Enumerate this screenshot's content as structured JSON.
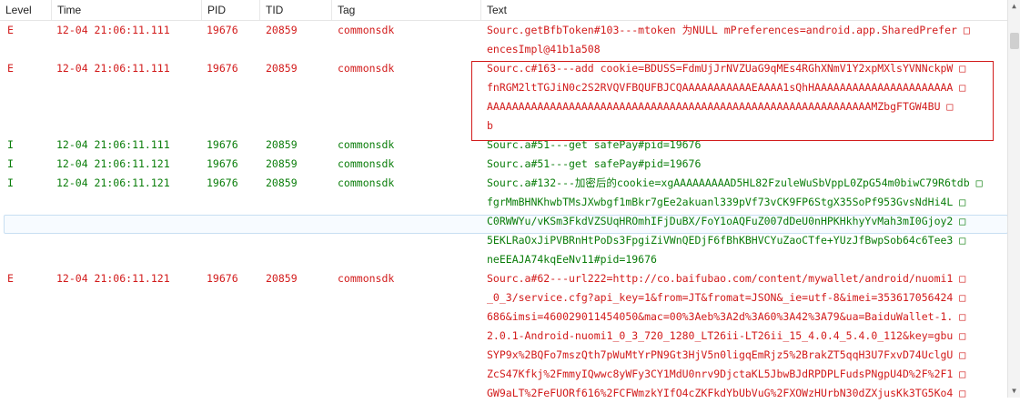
{
  "header": {
    "level": "Level",
    "time": "Time",
    "pid": "PID",
    "tid": "TID",
    "tag": "Tag",
    "text": "Text"
  },
  "colors": {
    "error": "#d21b1b",
    "info": "#0a7d0a"
  },
  "rows": [
    {
      "level": "E",
      "time": "12-04 21:06:11.111",
      "pid": "19676",
      "tid": "20859",
      "tag": "commonsdk",
      "lines": [
        "Sourc.getBfbToken#103---mtoken 为NULL mPreferences=android.app.SharedPrefer □",
        "encesImpl@41b1a508"
      ]
    },
    {
      "level": "E",
      "time": "12-04 21:06:11.111",
      "pid": "19676",
      "tid": "20859",
      "tag": "commonsdk",
      "lines": [
        "Sourc.c#163---add cookie=BDUSS=FdmUjJrNVZUaG9qMEs4RGhXNmV1Y2xpMXlsYVNNckpW □",
        "fnRGM2ltTGJiN0c2S2RVQVFBQUFBJCQAAAAAAAAAAAEAAAA1sQhHAAAAAAAAAAAAAAAAAAAAAA □",
        "AAAAAAAAAAAAAAAAAAAAAAAAAAAAAAAAAAAAAAAAAAAAAAAAAAAAAAAAAAAAAMZbgFTGW4BU □",
        "b"
      ]
    },
    {
      "level": "I",
      "time": "12-04 21:06:11.111",
      "pid": "19676",
      "tid": "20859",
      "tag": "commonsdk",
      "lines": [
        "Sourc.a#51---get safePay#pid=19676"
      ]
    },
    {
      "level": "I",
      "time": "12-04 21:06:11.121",
      "pid": "19676",
      "tid": "20859",
      "tag": "commonsdk",
      "lines": [
        "Sourc.a#51---get safePay#pid=19676"
      ]
    },
    {
      "level": "I",
      "time": "12-04 21:06:11.121",
      "pid": "19676",
      "tid": "20859",
      "tag": "commonsdk",
      "lines": [
        "Sourc.a#132---加密后的cookie=xgAAAAAAAAAD5HL82FzuleWuSbVppL0ZpG54m0biwC79R6tdb □",
        "fgrMmBHNKhwbTMsJXwbgf1mBkr7gEe2akuanl339pVf73vCK9FP6StgX35SoPf953GvsNdHi4L □",
        "C0RWWYu/vKSm3FkdVZSUqHROmhIFjDuBX/FoY1oAQFuZ007dDeU0nHPKHkhyYvMah3mI0Gjoy2 □",
        "5EKLRaOxJiPVBRnHtPoDs3FpgiZiVWnQEDjF6fBhKBHVCYuZaoCTfe+YUzJfBwpSob64c6Tee3 □",
        "neEEAJA74kqEeNv11#pid=19676"
      ]
    },
    {
      "level": "E",
      "time": "12-04 21:06:11.121",
      "pid": "19676",
      "tid": "20859",
      "tag": "commonsdk",
      "lines": [
        "Sourc.a#62---url222=http://co.baifubao.com/content/mywallet/android/nuomi1 □",
        "_0_3/service.cfg?api_key=1&from=JT&fromat=JSON&_ie=utf-8&imei=353617056424 □",
        "686&imsi=460029011454050&mac=00%3Aeb%3A2d%3A60%3A42%3A79&ua=BaiduWallet-1. □",
        "2.0.1-Android-nuomi1_0_3_720_1280_LT26ii-LT26ii_15_4.0.4_5.4.0_112&key=gbu □",
        "SYP9x%2BQFo7mszQth7pWuMtYrPN9Gt3HjV5n0ligqEmRjz5%2BrakZT5qqH3U7FxvD74UclgU □",
        "ZcS47Kfkj%2FmmyIQwwc8yWFy3CY1MdU0nrv9DjctaKL5JbwBJdRPDPLFudsPNgpU4D%2F%2F1 □",
        "GW9aLT%2FeFUORf616%2FCFWmzkYIfO4cZKFkdYbUbVuG%2FXOWzHUrbN30dZXjusKk3TG5Ko4 □"
      ]
    }
  ]
}
